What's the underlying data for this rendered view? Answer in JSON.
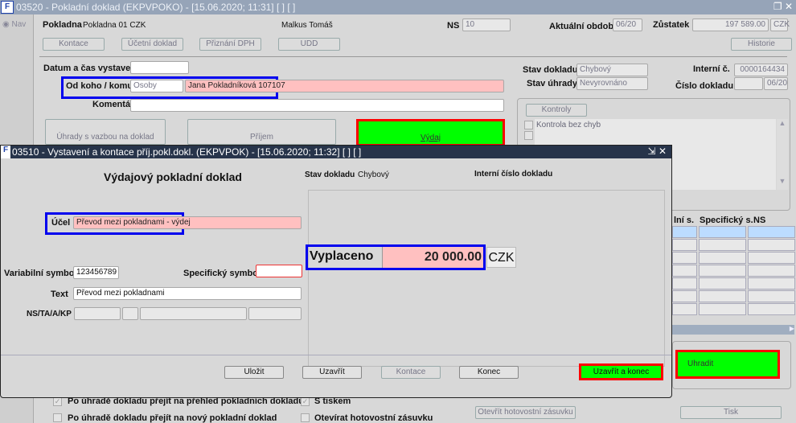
{
  "main": {
    "title": "03520 - Pokladní doklad (EKPVPOKO) - [15.06.2020; 11:31]  [ ]  [ ]",
    "nav_label": "Nav",
    "pokladna_label": "Pokladna",
    "pokladna_value": "Pokladna 01 CZK",
    "user": "Malkus Tomáš",
    "ns_label": "NS",
    "ns_value": "10",
    "obdobi_label": "Aktuální období",
    "obdobi_value": "06/20",
    "zustatek_label": "Zůstatek",
    "zustatek_value": "197 589.00",
    "zustatek_currency": "CZK",
    "buttons": {
      "kontace": "Kontace",
      "ucetni": "Účetní doklad",
      "dph": "Přiznání DPH",
      "udd": "UDD",
      "historie": "Historie",
      "uhrady": "Úhrady s vazbou na doklad",
      "prijem": "Příjem",
      "vydaj": "Výdaj",
      "kontroly": "Kontroly",
      "uhradit": "Uhradit",
      "zasuvka": "Otevřít hotovostní zásuvku",
      "tisk": "Tisk"
    },
    "datum_label": "Datum a čas vystavení",
    "datum_value": "",
    "odkoho_label": "Od koho / komu",
    "odkoho_type": "Osoby",
    "odkoho_value": "Jana Pokladníková 107107",
    "komentar_label": "Komentář",
    "komentar_value": "",
    "stav_dokladu_label": "Stav dokladu",
    "stav_dokladu_value": "Chybový",
    "stav_uhrady_label": "Stav úhrady",
    "stav_uhrady_value": "Nevyrovnáno",
    "interni_label": "Interní č.",
    "interni_value": "0000164434",
    "cislo_label": "Číslo dokladu",
    "cislo_value": "",
    "cislo_period": "06/20",
    "kontrola_item": "Kontrola bez chyb",
    "table_headers": [
      "lní s.",
      "Specifický s.",
      "NS"
    ],
    "checkboxes": [
      {
        "label": "Po úhradě dokladu přejít na přehled pokladních dokladů",
        "checked": true
      },
      {
        "label": "Po úhradě dokladu přejít na nový pokladní doklad",
        "checked": false
      },
      {
        "label": "S tiskem",
        "checked": true
      },
      {
        "label": "Otevírat hotovostní zásuvku",
        "checked": false
      }
    ]
  },
  "dialog": {
    "title": "03510 - Vystavení a kontace příj.pokl.dokl. (EKPVPOK) - [15.06.2020; 11:32]  [ ]  [ ]",
    "heading": "Výdajový pokladní doklad",
    "stav_label": "Stav dokladu",
    "stav_value": "Chybový",
    "interni_label": "Interní číslo dokladu",
    "ucel_label": "Účel",
    "ucel_value": "Převod mezi pokladnami - výdej",
    "vs_label": "Variabilní symbol",
    "vs_value": "123456789",
    "ss_label": "Specifický symbol",
    "ss_value": "",
    "text_label": "Text",
    "text_value": "Převod mezi pokladnami",
    "ns_label": "NS/TA/A/KP",
    "vyplaceno_label": "Vyplaceno",
    "vyplaceno_value": "20 000.00",
    "currency": "CZK",
    "buttons": {
      "ulozit": "Uložit",
      "uzavrit": "Uzavřít",
      "kontace": "Kontace",
      "konec": "Konec",
      "uzavrit_konec": "Uzavřít a konec"
    }
  }
}
